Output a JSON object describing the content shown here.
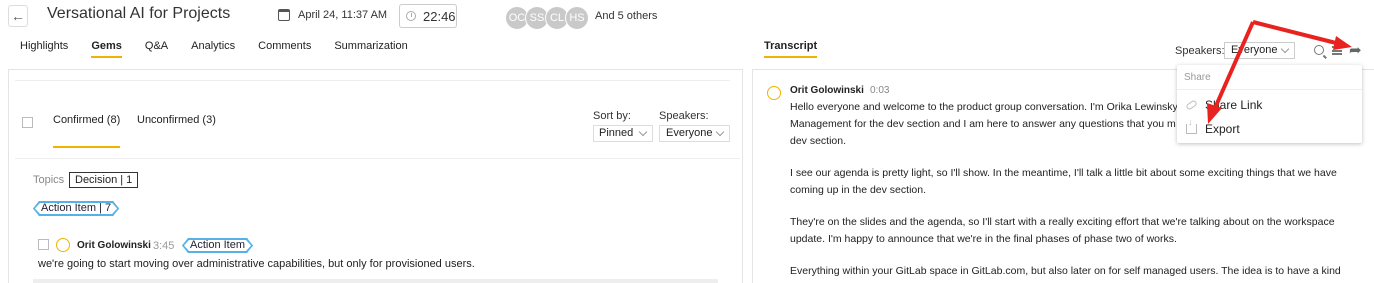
{
  "header": {
    "title": "Versational AI for Projects",
    "date": "April 24, 11:37 AM",
    "duration": "22:46",
    "participants": [
      "OC",
      "SS",
      "CL",
      "HS"
    ],
    "others": "And 5 others"
  },
  "tabs": [
    "Highlights",
    "Gems",
    "Q&A",
    "Analytics",
    "Comments",
    "Summarization"
  ],
  "active_tab": "Gems",
  "gems": {
    "confirmed_label": "Confirmed (8)",
    "unconfirmed_label": "Unconfirmed (3)",
    "sort_label": "Sort by:",
    "sort_value": "Pinned",
    "speakers_label": "Speakers:",
    "speakers_value": "Everyone",
    "topics_label": "Topics",
    "topic_chip": "Decision | 1",
    "action_chip": "Action Item | 7",
    "item": {
      "speaker": "Orit Golowinski",
      "time": "3:45",
      "tag": "Action Item",
      "text": "we're going to start moving over administrative capabilities, but only for provisioned users."
    }
  },
  "transcript": {
    "tab_label": "Transcript",
    "speakers_label": "Speakers:",
    "speakers_value": "Everyone",
    "speaker": "Orit Golowinski",
    "time": "0:03",
    "paragraphs": [
      "Hello everyone and welcome to the product group conversation. I'm Orika Lewinsky\nManagement for the dev section and I am here to answer any questions that you m\ndev section.",
      "I see our agenda is pretty light, so I'll show. In the meantime, I'll talk a little bit about some exciting things that we have\ncoming up in the dev section.",
      "They're on the slides and the agenda, so I'll start with a really exciting effort that we're talking about on the workspace\nupdate. I'm happy to announce that we're in the final phases of phase two of works.",
      "Everything within your GitLab space in GitLab.com, but also later on for self managed users. The idea is to have a kind"
    ]
  },
  "share_menu": {
    "title": "Share",
    "items": [
      "Share Link",
      "Export"
    ]
  },
  "colors": {
    "accent": "#f0b400",
    "tag_border": "#58b0e8",
    "annotation_arrow": "#e8231f"
  }
}
